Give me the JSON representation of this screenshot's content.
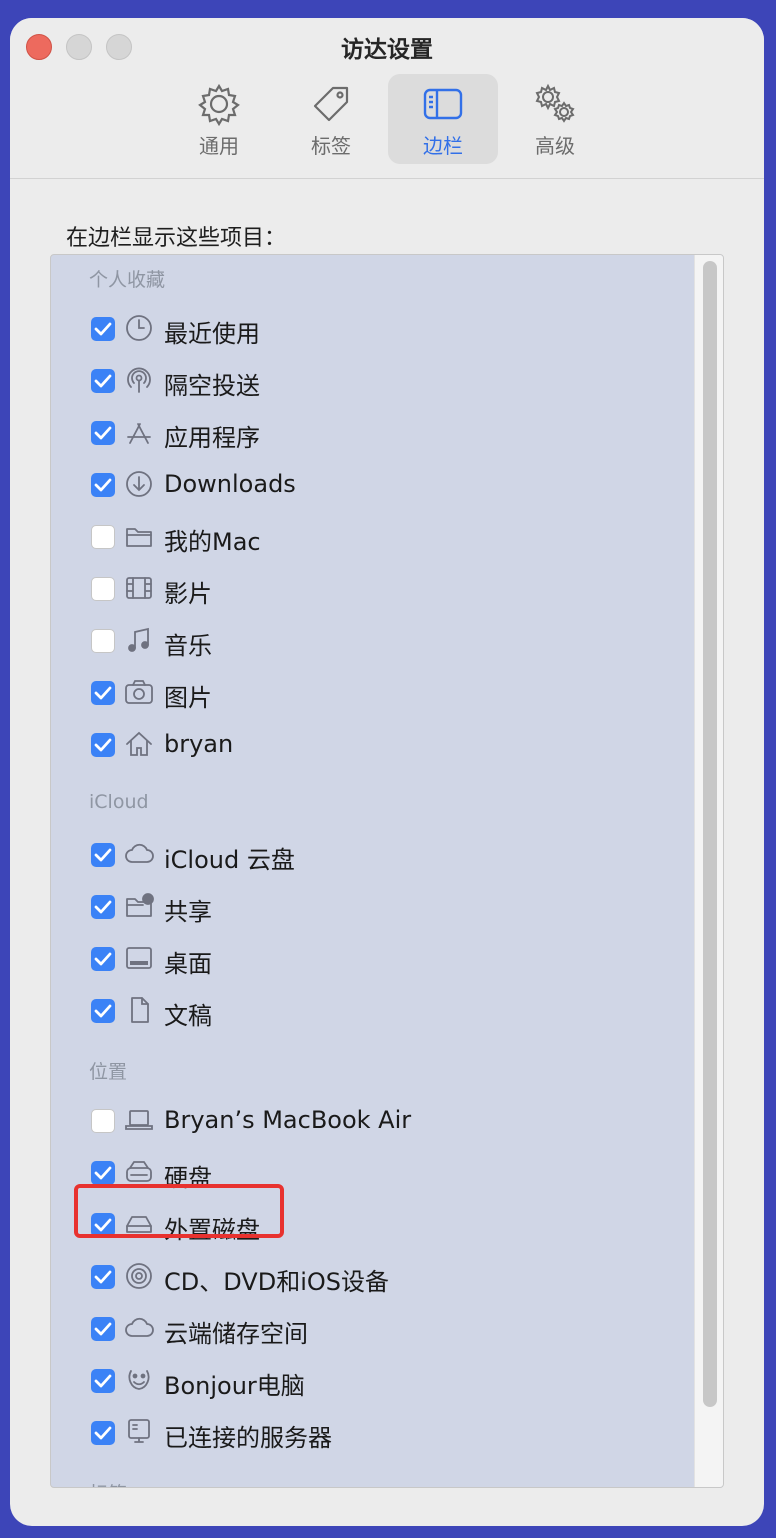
{
  "window": {
    "title": "访达设置"
  },
  "tabs": [
    {
      "label": "通用",
      "icon": "gear-icon"
    },
    {
      "label": "标签",
      "icon": "tag-icon"
    },
    {
      "label": "边栏",
      "icon": "sidebar-icon",
      "active": true
    },
    {
      "label": "高级",
      "icon": "gears-icon"
    }
  ],
  "heading": "在边栏显示这些项目：",
  "sections": [
    {
      "label": "个人收藏",
      "items": [
        {
          "label": "最近使用",
          "checked": true,
          "icon": "clock-icon"
        },
        {
          "label": "隔空投送",
          "checked": true,
          "icon": "airdrop-icon"
        },
        {
          "label": "应用程序",
          "checked": true,
          "icon": "apps-icon"
        },
        {
          "label": "Downloads",
          "checked": true,
          "icon": "download-icon"
        },
        {
          "label": "我的Mac",
          "checked": false,
          "icon": "folder-icon"
        },
        {
          "label": "影片",
          "checked": false,
          "icon": "film-icon"
        },
        {
          "label": "音乐",
          "checked": false,
          "icon": "music-icon"
        },
        {
          "label": "图片",
          "checked": true,
          "icon": "camera-icon"
        },
        {
          "label": "bryan",
          "checked": true,
          "icon": "home-icon"
        }
      ]
    },
    {
      "label": "iCloud",
      "items": [
        {
          "label": "iCloud 云盘",
          "checked": true,
          "icon": "cloud-icon"
        },
        {
          "label": "共享",
          "checked": true,
          "icon": "shared-folder-icon"
        },
        {
          "label": "桌面",
          "checked": true,
          "icon": "desktop-icon"
        },
        {
          "label": "文稿",
          "checked": true,
          "icon": "document-icon"
        }
      ]
    },
    {
      "label": "位置",
      "items": [
        {
          "label": "Bryan’s MacBook Air",
          "checked": false,
          "icon": "laptop-icon"
        },
        {
          "label": "硬盘",
          "checked": true,
          "icon": "hard-disk-icon"
        },
        {
          "label": "外置磁盘",
          "checked": true,
          "icon": "external-disk-icon"
        },
        {
          "label": "CD、DVD和iOS设备",
          "checked": true,
          "icon": "disc-icon"
        },
        {
          "label": "云端储存空间",
          "checked": true,
          "icon": "cloud-icon"
        },
        {
          "label": "Bonjour电脑",
          "checked": true,
          "icon": "bonjour-icon"
        },
        {
          "label": "已连接的服务器",
          "checked": true,
          "icon": "server-icon"
        }
      ]
    },
    {
      "label": "标签",
      "items": []
    }
  ],
  "colors": {
    "accent": "#3b82f6",
    "highlight": "#e8322f",
    "list_bg": "#d0d6e6"
  }
}
